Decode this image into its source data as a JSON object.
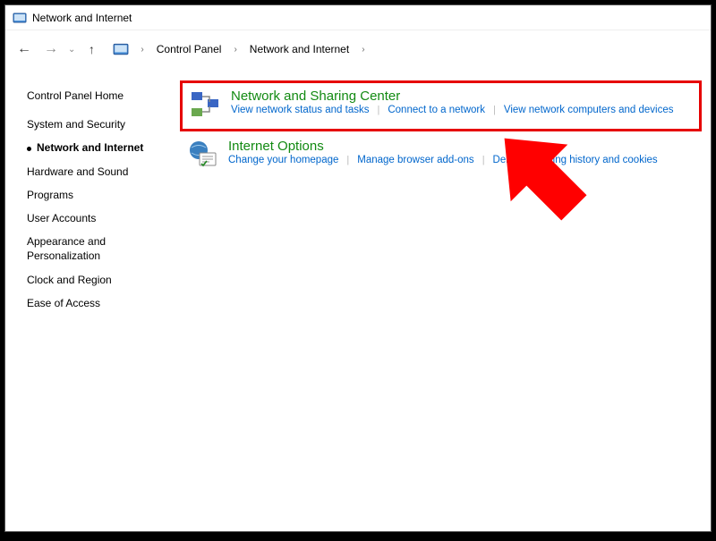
{
  "window": {
    "title": "Network and Internet"
  },
  "breadcrumb": {
    "items": [
      "Control Panel",
      "Network and Internet"
    ]
  },
  "sidebar": {
    "home": "Control Panel Home",
    "items": [
      {
        "label": "System and Security",
        "selected": false
      },
      {
        "label": "Network and Internet",
        "selected": true
      },
      {
        "label": "Hardware and Sound",
        "selected": false
      },
      {
        "label": "Programs",
        "selected": false
      },
      {
        "label": "User Accounts",
        "selected": false
      },
      {
        "label": "Appearance and Personalization",
        "selected": false
      },
      {
        "label": "Clock and Region",
        "selected": false
      },
      {
        "label": "Ease of Access",
        "selected": false
      }
    ]
  },
  "main": {
    "categories": [
      {
        "title": "Network and Sharing Center",
        "links": [
          "View network status and tasks",
          "Connect to a network",
          "View network computers and devices"
        ],
        "highlight": true,
        "iconColors": {
          "a": "#3a66c4",
          "b": "#6aa84f"
        }
      },
      {
        "title": "Internet Options",
        "links": [
          "Change your homepage",
          "Manage browser add-ons",
          "Delete browsing history and cookies"
        ],
        "highlight": false,
        "iconColors": {
          "a": "#3a7fbf",
          "b": "#dce6e0"
        }
      }
    ]
  },
  "annotation": {
    "arrowColor": "#ff0000"
  }
}
